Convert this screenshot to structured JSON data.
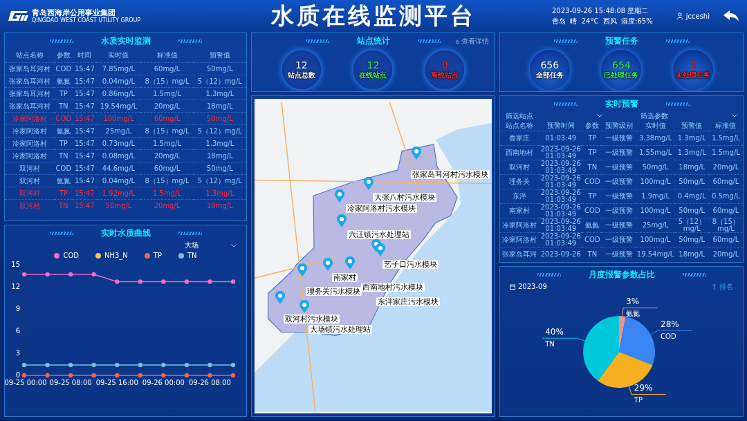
{
  "header": {
    "logo_text": "青岛西海岸公用事业集团",
    "logo_subtext": "QINGDAO WEST COAST UTILITY GROUP",
    "title": "水质在线监测平台",
    "datetime": "2023-09-26 15:48:08 星期二",
    "weather": "青岛  晴  24°C  西风  湿度:65%",
    "user": "jcceshi"
  },
  "water_quality": {
    "title": "水质实时监测",
    "columns": [
      "站点名称",
      "参数",
      "时间",
      "实时值",
      "标准值",
      "预警值"
    ],
    "rows": [
      {
        "cells": [
          "张家岛耳河村",
          "COD",
          "15:47",
          "7.85mg/L",
          "60mg/L",
          "50mg/L"
        ],
        "alarm": false
      },
      {
        "cells": [
          "张家岛耳河村",
          "氨氮",
          "15:47",
          "0.04mg/L",
          "8（15）mg/L",
          "5（12）mg/L"
        ],
        "alarm": false
      },
      {
        "cells": [
          "张家岛耳河村",
          "TP",
          "15:47",
          "0.86mg/L",
          "1.5mg/L",
          "1.3mg/L"
        ],
        "alarm": false
      },
      {
        "cells": [
          "张家岛耳河村",
          "TN",
          "15:47",
          "19.54mg/L",
          "20mg/L",
          "18mg/L"
        ],
        "alarm": false
      },
      {
        "cells": [
          "冷家阿洛村",
          "COD",
          "15:47",
          "100mg/L",
          "60mg/L",
          "50mg/L"
        ],
        "alarm": true
      },
      {
        "cells": [
          "冷家阿洛村",
          "氨氮",
          "15:47",
          "25mg/L",
          "8（15）mg/L",
          "5（12）mg/L"
        ],
        "alarm": false
      },
      {
        "cells": [
          "冷家阿洛村",
          "TP",
          "15:47",
          "0.73mg/L",
          "1.5mg/L",
          "1.3mg/L"
        ],
        "alarm": false
      },
      {
        "cells": [
          "冷家阿洛村",
          "TN",
          "15:47",
          "0.08mg/L",
          "20mg/L",
          "18mg/L"
        ],
        "alarm": false
      },
      {
        "cells": [
          "双河村",
          "COD",
          "15:47",
          "44.6mg/L",
          "60mg/L",
          "50mg/L"
        ],
        "alarm": false
      },
      {
        "cells": [
          "双河村",
          "氨氮",
          "15:47",
          "0.04mg/L",
          "8（15）mg/L",
          "5（12）mg/L"
        ],
        "alarm": false
      },
      {
        "cells": [
          "双河村",
          "TP",
          "15:47",
          "1.92mg/L",
          "1.5mg/L",
          "1.3mg/L"
        ],
        "alarm": true
      },
      {
        "cells": [
          "双河村",
          "TN",
          "15:47",
          "50mg/L",
          "20mg/L",
          "18mg/L"
        ],
        "alarm": true
      }
    ]
  },
  "realtime_curve": {
    "title": "实时水质曲线",
    "station": "大场",
    "chart_data": {
      "type": "line",
      "categories": [
        "09-25 00:00",
        null,
        "09-25 08:00",
        null,
        "09-25 16:00",
        null,
        "09-26 00:00",
        null,
        "09-26 08:00",
        null
      ],
      "ylim": [
        0,
        15
      ],
      "yticks": [
        0,
        3,
        6,
        9,
        12,
        15
      ],
      "series": [
        {
          "name": "COD",
          "color": "#f06bc4",
          "marker": true,
          "values": [
            13.7,
            13.7,
            13.7,
            13.7,
            12.7,
            12.7,
            12.7,
            12.7,
            12.7,
            12.7
          ]
        },
        {
          "name": "NH3_N",
          "color": "#f7c948",
          "marker": true,
          "values": [
            null,
            null,
            null,
            null,
            null,
            null,
            null,
            null,
            null,
            null
          ]
        },
        {
          "name": "TP",
          "color": "#ee6651",
          "marker": true,
          "values": [
            0,
            0,
            0,
            0,
            0,
            0,
            0,
            0,
            0,
            0
          ]
        },
        {
          "name": "TN",
          "color": "#73c0de",
          "marker": true,
          "values": [
            1.4,
            1.4,
            1.4,
            1.4,
            1.4,
            1.4,
            1.4,
            1.4,
            1.4,
            1.4
          ]
        }
      ]
    }
  },
  "station_stats": {
    "title": "站点统计",
    "link": "查看详情",
    "stats": [
      {
        "value": "12",
        "label": "站点总数",
        "color": "#ffffff"
      },
      {
        "value": "12",
        "label": "在线站点",
        "color": "#39f05a"
      },
      {
        "value": "0",
        "label": "离线站点",
        "color": "#ff2a2a"
      }
    ]
  },
  "map": {
    "markers": [
      {
        "label": "张家岛耳河村污水模块"
      },
      {
        "label": "大张八村污水模块"
      },
      {
        "label": "冷家阿洛村污水模块"
      },
      {
        "label": "六汪镇污水处理站"
      },
      {
        "label": "艺子口污水模块"
      },
      {
        "label": "南家村"
      },
      {
        "label": "理务关污水模块"
      },
      {
        "label": "西南地村污水模块"
      },
      {
        "label": "东泮家庄污水模块"
      },
      {
        "label": "双河村污水模块"
      },
      {
        "label": "大场镇污水处理站"
      }
    ]
  },
  "warning_tasks": {
    "title": "预警任务",
    "stats": [
      {
        "value": "656",
        "label": "全部任务",
        "color": "#ffffff"
      },
      {
        "value": "654",
        "label": "已处理任务",
        "color": "#39f05a"
      },
      {
        "value": "2",
        "label": "未处理任务",
        "color": "#ff2a2a"
      }
    ]
  },
  "realtime_alerts": {
    "title": "实时预警",
    "filters": [
      "筛选站点",
      "筛选参数"
    ],
    "columns": [
      "站点名称",
      "预警时间",
      "参数",
      "预警级别",
      "实时值",
      "预警值",
      "标准值"
    ],
    "rows": [
      [
        "香家庄",
        "01:03:49",
        "TP",
        "一级预警",
        "3.38mg/L",
        "1.3mg/L",
        "1.5mg/L"
      ],
      [
        "西南地村",
        "2023-09-26 01:03:49",
        "TP",
        "一级预警",
        "1.55mg/L",
        "1.3mg/L",
        "1.5mg/L"
      ],
      [
        "双河村",
        "2023-09-26 01:03:49",
        "TN",
        "一级预警",
        "50mg/L",
        "18mg/L",
        "20mg/L"
      ],
      [
        "理务关",
        "2023-09-26 01:03:49",
        "COD",
        "一级预警",
        "100mg/L",
        "50mg/L",
        "60mg/L"
      ],
      [
        "东泮",
        "2023-09-26 01:03:49",
        "TP",
        "一级预警",
        "1.9mg/L",
        "0.4mg/L",
        "0.5mg/L"
      ],
      [
        "南家村",
        "2023-09-26 01:03:49",
        "COD",
        "一级预警",
        "100mg/L",
        "50mg/L",
        "60mg/L"
      ],
      [
        "冷家阿洛村",
        "2023-09-26 01:03:49",
        "氨氮",
        "一级预警",
        "25mg/L",
        "5（12）mg/L",
        "8（15）mg/L"
      ],
      [
        "冷家阿洛村",
        "2023-09-26 01:03:49",
        "COD",
        "一级预警",
        "100mg/L",
        "50mg/L",
        "60mg/L"
      ],
      [
        "张家岛耳河",
        "2023-09-26",
        "TN",
        "一级预警",
        "19.54mg/L",
        "18mg/L",
        "20mg/L"
      ]
    ]
  },
  "monthly_alarm": {
    "title": "月度报警参数占比",
    "month": "2023-09",
    "rank": "排名",
    "chart_data": {
      "type": "pie",
      "categories": [
        "氨氮",
        "COD",
        "TP",
        "TN"
      ],
      "values": [
        3,
        28,
        29,
        40
      ],
      "colors": [
        "#e8948f",
        "#3a86f5",
        "#f7b021",
        "#00c8d8"
      ],
      "value_labels": [
        "3%",
        "28%",
        "29%",
        "40%"
      ]
    }
  }
}
